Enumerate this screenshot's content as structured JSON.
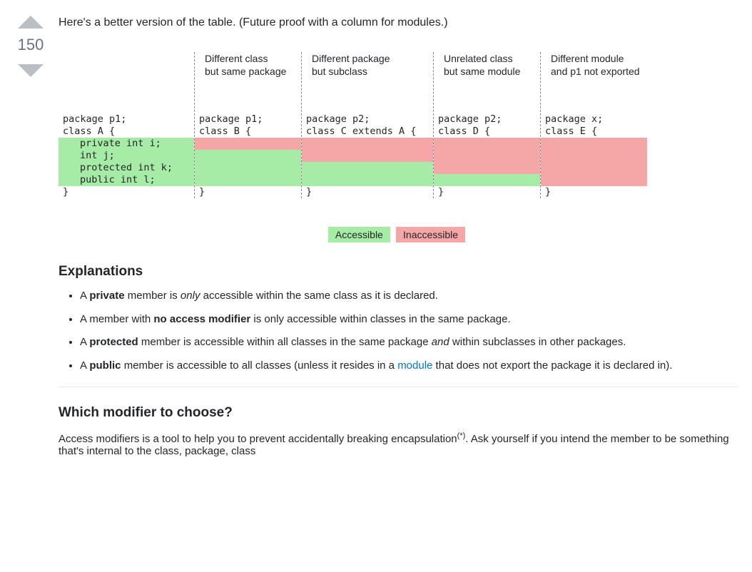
{
  "vote": {
    "score": "150"
  },
  "lead": "Here's a better version of the table. (Future proof with a column for modules.)",
  "diagram": {
    "columns": [
      {
        "head1": "",
        "head2": "",
        "pkg": "package p1;",
        "cls": "class A {",
        "rows": [
          {
            "text": "private int i;",
            "class": "g"
          },
          {
            "text": "int j;",
            "class": "g"
          },
          {
            "text": "protected int k;",
            "class": "g"
          },
          {
            "text": "public int l;",
            "class": "g"
          }
        ]
      },
      {
        "head1": "Different class",
        "head2": "but same package",
        "pkg": "package p1;",
        "cls": "class B {",
        "rows": [
          {
            "text": "",
            "class": "r"
          },
          {
            "text": "",
            "class": "g"
          },
          {
            "text": "",
            "class": "g"
          },
          {
            "text": "",
            "class": "g"
          }
        ]
      },
      {
        "head1": "Different package",
        "head2": "but subclass",
        "pkg": "package p2;",
        "cls": "class C extends A {",
        "rows": [
          {
            "text": "",
            "class": "r"
          },
          {
            "text": "",
            "class": "r"
          },
          {
            "text": "",
            "class": "g"
          },
          {
            "text": "",
            "class": "g"
          }
        ]
      },
      {
        "head1": "Unrelated class",
        "head2": "but same module",
        "pkg": "package p2;",
        "cls": "class D {",
        "rows": [
          {
            "text": "",
            "class": "r"
          },
          {
            "text": "",
            "class": "r"
          },
          {
            "text": "",
            "class": "r"
          },
          {
            "text": "",
            "class": "g"
          }
        ]
      },
      {
        "head1": "Different module",
        "head2": "and p1 not exported",
        "pkg": "package x;",
        "cls": "class E {",
        "rows": [
          {
            "text": "",
            "class": "r"
          },
          {
            "text": "",
            "class": "r"
          },
          {
            "text": "",
            "class": "r"
          },
          {
            "text": "",
            "class": "r"
          }
        ]
      }
    ],
    "closeBrace": "}",
    "legend": {
      "ok": "Accessible",
      "no": "Inaccessible"
    }
  },
  "explanations": {
    "title": "Explanations",
    "items": {
      "private": {
        "pre": "A ",
        "strong": "private",
        "post": " member is ",
        "em": "only",
        "tail": " accessible within the same class as it is declared."
      },
      "default": {
        "pre": "A member with ",
        "strong": "no access modifier",
        "post": " is only accessible within classes in the same package."
      },
      "protected": {
        "pre": "A ",
        "strong": "protected",
        "post": " member is accessible within all classes in the same package ",
        "em": "and",
        "tail": " within subclasses in other packages."
      },
      "public": {
        "pre": "A ",
        "strong": "public",
        "post": " member is accessible to all classes (unless it resides in a ",
        "link": "module",
        "tail": " that does not export the package it is declared in)."
      }
    }
  },
  "which": {
    "title": "Which modifier to choose?",
    "para_pre": "Access modifiers is a tool to help you to prevent accidentally breaking encapsulation",
    "sup": "(*)",
    "para_post": ". Ask yourself if you intend the member to be something that's internal to the class, package, class"
  }
}
